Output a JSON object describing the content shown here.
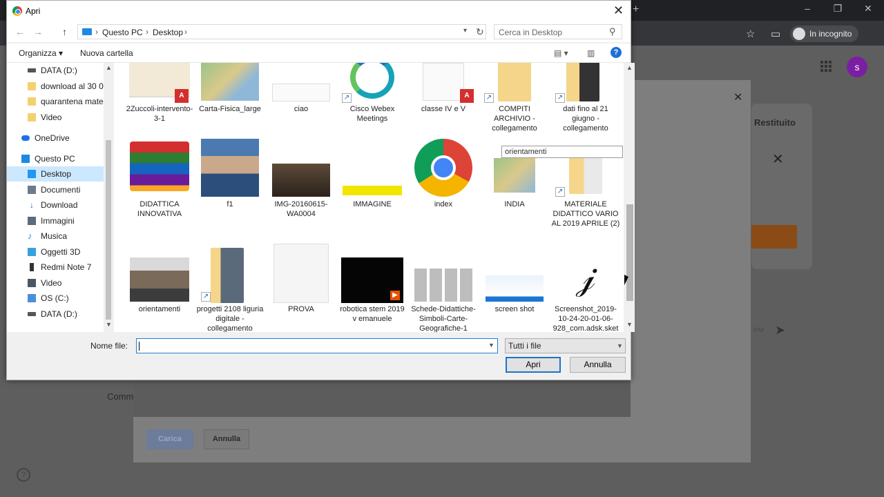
{
  "browser": {
    "incognito_label": "In incognito",
    "avatar_letter": "s"
  },
  "background": {
    "restituito_label": "Restituito",
    "comm_label": "Comm",
    "carica_button": "Carica",
    "annulla_button": "Annulla",
    "send_placeholder": "invi"
  },
  "dialog": {
    "title": "Apri",
    "breadcrumb": [
      "Questo PC",
      "Desktop"
    ],
    "search_placeholder": "Cerca in Desktop",
    "organize_label": "Organizza",
    "new_folder_label": "Nuova cartella",
    "help_label": "?",
    "nav_items": [
      {
        "label": "DATA (D:)",
        "icon": "drive-icon"
      },
      {
        "label": "download al 30 0",
        "icon": "folder-icon"
      },
      {
        "label": "quarantena mate",
        "icon": "folder-icon"
      },
      {
        "label": "Video",
        "icon": "folder-icon"
      },
      {
        "label": "OneDrive",
        "icon": "cloud-icon"
      },
      {
        "label": "Questo PC",
        "icon": "pc-icon"
      },
      {
        "label": "Desktop",
        "icon": "desktop-icon"
      },
      {
        "label": "Documenti",
        "icon": "documents-icon"
      },
      {
        "label": "Download",
        "icon": "download-icon"
      },
      {
        "label": "Immagini",
        "icon": "images-icon"
      },
      {
        "label": "Musica",
        "icon": "music-icon"
      },
      {
        "label": "Oggetti 3D",
        "icon": "3d-objects-icon"
      },
      {
        "label": "Redmi Note 7",
        "icon": "phone-icon"
      },
      {
        "label": "Video",
        "icon": "video-icon"
      },
      {
        "label": "OS (C:)",
        "icon": "os-drive-icon"
      },
      {
        "label": "DATA (D:)",
        "icon": "drive-icon"
      }
    ],
    "files": [
      {
        "label": "2Zuccoli-intervento-3-1"
      },
      {
        "label": "Carta-Fisica_large"
      },
      {
        "label": "ciao"
      },
      {
        "label": "Cisco Webex Meetings"
      },
      {
        "label": "classe IV  e V"
      },
      {
        "label": "COMPITI ARCHIVIO - collegamento"
      },
      {
        "label": "dati fino al 21 giugno - collegamento"
      },
      {
        "label": "DIDATTICA INNOVATIVA"
      },
      {
        "label": "f1"
      },
      {
        "label": "IMG-20160615-WA0004"
      },
      {
        "label": "IMMAGINE"
      },
      {
        "label": "index"
      },
      {
        "label": "INDIA"
      },
      {
        "label": "MATERIALE DIDATTICO VARIO AL 2019 APRILE (2)"
      },
      {
        "label": "orientamenti"
      },
      {
        "label": "progetti 2108 liguria digitale - collegamento"
      },
      {
        "label": "PROVA"
      },
      {
        "label": "robotica stem 2019 v emanuele"
      },
      {
        "label": "Schede-Didattiche-Simboli-Carte-Geografiche-1"
      },
      {
        "label": "screen shot"
      },
      {
        "label": "Screenshot_2019-10-24-20-01-06-928_com.adsk.sket"
      }
    ],
    "tooltip": "orientamenti",
    "filename_label": "Nome file:",
    "filename_value": "",
    "filetype_value": "Tutti i file",
    "open_button": "Apri",
    "cancel_button": "Annulla"
  }
}
